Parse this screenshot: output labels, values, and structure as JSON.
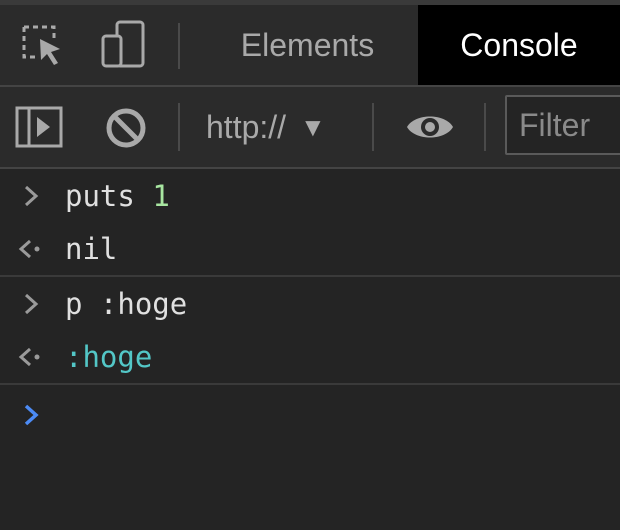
{
  "tabs": {
    "elements_label": "Elements",
    "console_label": "Console"
  },
  "toolbar": {
    "context_label": "http://",
    "context_arrow": "▼",
    "filter_placeholder": "Filter"
  },
  "console": {
    "entries": [
      {
        "type": "input",
        "parts": [
          "puts ",
          "1"
        ]
      },
      {
        "type": "output",
        "text": "nil"
      },
      {
        "type": "input",
        "text": "p :hoge"
      },
      {
        "type": "output",
        "text": ":hoge"
      }
    ]
  },
  "colors": {
    "background": "#242424",
    "panel": "#2b2b2b",
    "active_tab": "#000000",
    "number": "#a8e6a1",
    "symbol": "#53c7c7",
    "prompt": "#4c8bf5"
  },
  "icons": {
    "inspect": "inspect-element-icon",
    "device": "device-toggle-icon",
    "sidebar": "sidebar-toggle-icon",
    "clear": "clear-console-icon",
    "live": "live-expression-eye-icon",
    "input_chevron": "input-chevron-icon",
    "output_arrow": "output-arrow-icon",
    "prompt_chevron": "prompt-chevron-icon"
  }
}
